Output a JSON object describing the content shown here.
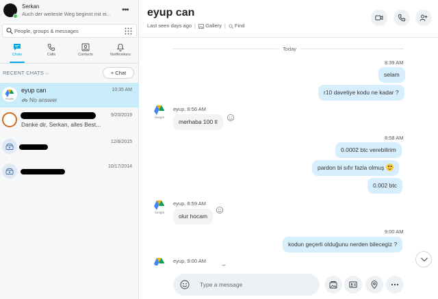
{
  "profile": {
    "name": "Serkan",
    "mood": "Auch der weiteste Weg beginnt mit ei...",
    "more": "•••"
  },
  "search": {
    "placeholder": "People, groups & messages"
  },
  "nav": {
    "tabs": [
      "Chats",
      "Calls",
      "Contacts",
      "Notifications"
    ]
  },
  "recent": {
    "label": "RECENT CHATS",
    "chevron": "⌵",
    "new_chat": "+ Chat"
  },
  "conversations": [
    {
      "name": "eyup can",
      "subtitle": "No answer",
      "date": "10:35 AM"
    },
    {
      "name": "",
      "subtitle": "Danke dir, Serkan, alles Best...",
      "date": "9/20/2019"
    },
    {
      "name": "",
      "subtitle": "",
      "date": "12/8/2015"
    },
    {
      "name": "",
      "subtitle": "",
      "date": "10/17/2014"
    }
  ],
  "header": {
    "title": "eyup can",
    "last_seen": "Last seen days ago",
    "gallery": "Gallery",
    "find": "Find",
    "separator": "|"
  },
  "messages": {
    "today": "Today",
    "t1": "8:39 AM",
    "m1": "selam",
    "m2": "r10 davetiye kodu ne kadar ?",
    "s1": "eyup, 8:56 AM",
    "m3": "merhaba 100 tl",
    "t2": "8:58 AM",
    "m4": "0.0002 btc verebilirim",
    "m5": "pardon bi sıfır fazla olmuş",
    "m6": "0.002 btc",
    "s2": "eyup, 8:59 AM",
    "m7": "olur hocam",
    "t3": "9:00 AM",
    "m8": "kodun geçerli olduğunu nerden bilecegiz ?",
    "s3": "eyup, 9:00 AM"
  },
  "compose": {
    "placeholder": "Type a message"
  },
  "colors": {
    "accent": "#00a8e6",
    "selected_row": "#c9ecfa",
    "outgoing": "#d7effc",
    "incoming": "#f1f3f5"
  }
}
